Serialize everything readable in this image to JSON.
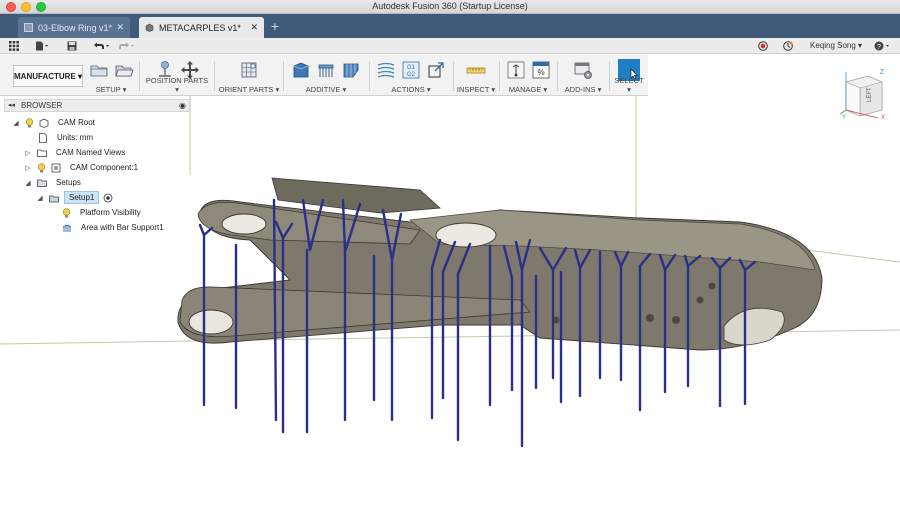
{
  "window": {
    "title": "Autodesk Fusion 360 (Startup License)"
  },
  "tabs": [
    {
      "label": "03-Elbow Ring v1*",
      "active": false
    },
    {
      "label": "METACARPLES v1*",
      "active": true
    }
  ],
  "user": {
    "name": "Keqing Song ▾"
  },
  "toolbar": {
    "workspace": "MANUFACTURE ▾",
    "groups": [
      {
        "label": "SETUP ▾"
      },
      {
        "label": "POSITION PARTS ▾"
      },
      {
        "label": "ORIENT PARTS ▾"
      },
      {
        "label": "ADDITIVE ▾"
      },
      {
        "label": "ACTIONS ▾"
      },
      {
        "label": "INSPECT ▾"
      },
      {
        "label": "MANAGE ▾"
      },
      {
        "label": "ADD-INS ▾"
      },
      {
        "label": "SELECT ▾"
      }
    ]
  },
  "browser": {
    "title": "BROWSER",
    "items": [
      {
        "label": "CAM Root"
      },
      {
        "label": "Units: mm"
      },
      {
        "label": "CAM Named Views"
      },
      {
        "label": "CAM Component:1"
      },
      {
        "label": "Setups"
      },
      {
        "label": "Setup1"
      },
      {
        "label": "Platform Visibility"
      },
      {
        "label": "Area with Bar Support1"
      }
    ]
  },
  "viewcube": {
    "face": "LEFT",
    "axis_z": "Z",
    "axis_y": "Y",
    "axis_x": "X"
  },
  "colors": {
    "tabbar": "#3f5a7a",
    "support": "#2b2f8a",
    "part": "#7d786b",
    "accent": "#1f7fc4"
  }
}
